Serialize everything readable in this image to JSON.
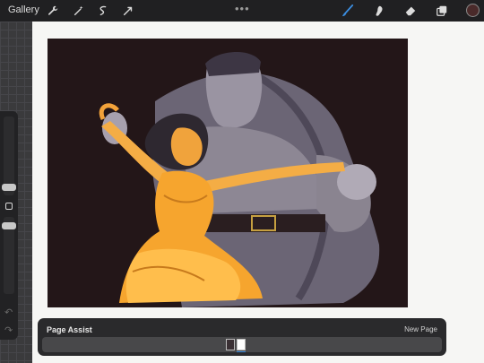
{
  "toolbar": {
    "gallery_label": "Gallery",
    "left_tools": [
      "wrench-icon",
      "magic-wand-icon",
      "selection-icon",
      "transform-icon"
    ],
    "more": "•••",
    "right_tools": [
      "brush-icon",
      "smudge-icon",
      "eraser-icon",
      "layers-icon"
    ],
    "active_tool": "brush-icon",
    "accent_color": "#3b8de0",
    "current_color": "#4a2a2a"
  },
  "sidebar": {
    "brush_size_level": 0.5,
    "opacity_level": 0.5
  },
  "page_assist": {
    "title": "Page Assist",
    "new_page": "New Page",
    "pages": [
      "page-1",
      "page-2"
    ],
    "selected_page": 2
  }
}
